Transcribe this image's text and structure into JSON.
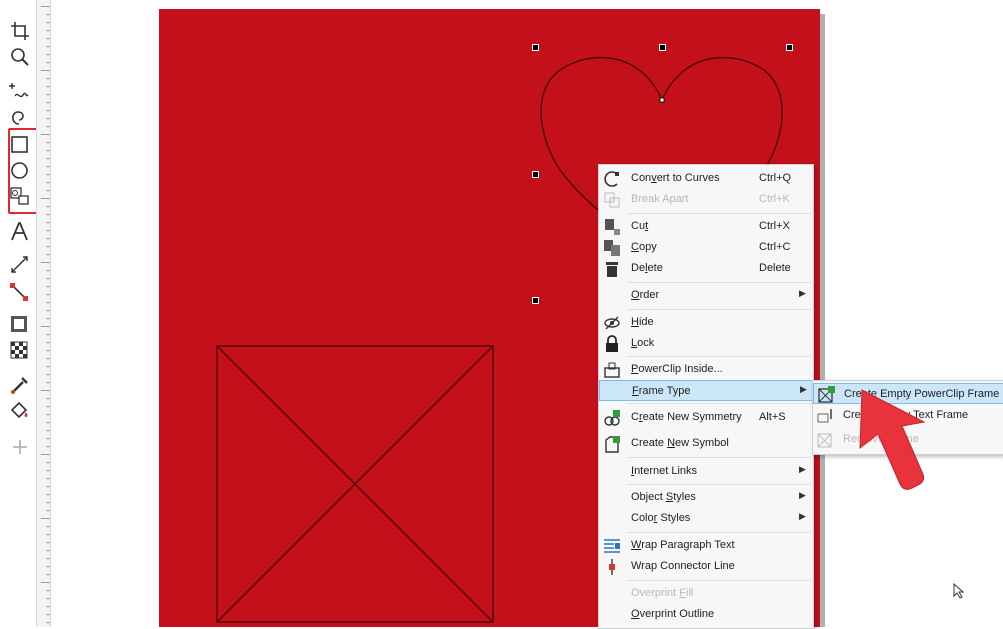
{
  "toolbox": {
    "tools": [
      {
        "name": "crop-tool-icon"
      },
      {
        "name": "zoom-tool-icon"
      },
      {
        "name": "freehand-tool-icon"
      },
      {
        "name": "artistic-media-tool-icon"
      },
      {
        "name": "rectangle-tool-icon"
      },
      {
        "name": "ellipse-tool-icon"
      },
      {
        "name": "placeholder-frame-tool-icon"
      },
      {
        "name": "text-tool-icon"
      },
      {
        "name": "dimension-tool-icon"
      },
      {
        "name": "connector-tool-icon"
      },
      {
        "name": "drop-shadow-tool-icon"
      },
      {
        "name": "transparency-tool-icon"
      },
      {
        "name": "eyedropper-tool-icon"
      },
      {
        "name": "interactive-fill-tool-icon"
      },
      {
        "name": "add-tool-icon"
      }
    ],
    "highlight_color": "#e0272f"
  },
  "canvas": {
    "page_color": "#c3101a",
    "outline_color": "#3a0306"
  },
  "context_menu": {
    "items": [
      {
        "label": "Convert to Curves",
        "mnemonic": "v",
        "shortcut": "Ctrl+Q",
        "disabled": false
      },
      {
        "label": "Break Apart",
        "shortcut": "Ctrl+K",
        "disabled": true
      },
      {
        "label": "Cut",
        "mnemonic": "t",
        "shortcut": "Ctrl+X",
        "disabled": false
      },
      {
        "label": "Copy",
        "mnemonic": "C",
        "shortcut": "Ctrl+C",
        "disabled": false
      },
      {
        "label": "Delete",
        "mnemonic": "l",
        "shortcut": "Delete",
        "disabled": false
      },
      {
        "label": "Order",
        "mnemonic": "O",
        "submenu": true
      },
      {
        "label": "Hide",
        "mnemonic": "H"
      },
      {
        "label": "Lock",
        "mnemonic": "L"
      },
      {
        "label": "PowerClip Inside...",
        "mnemonic": "P"
      },
      {
        "label": "Frame Type",
        "mnemonic": "F",
        "submenu": true,
        "highlighted": true
      },
      {
        "label": "Create New Symmetry",
        "mnemonic": "r",
        "shortcut": "Alt+S"
      },
      {
        "label": "Create New Symbol",
        "mnemonic": "N"
      },
      {
        "label": "Internet Links",
        "mnemonic": "I",
        "submenu": true
      },
      {
        "label": "Object Styles",
        "mnemonic": "S",
        "submenu": true
      },
      {
        "label": "Color Styles",
        "mnemonic": "r",
        "submenu": true
      },
      {
        "label": "Wrap Paragraph Text",
        "mnemonic": "W"
      },
      {
        "label": "Wrap Connector Line"
      },
      {
        "label": "Overprint Fill",
        "mnemonic": "F",
        "disabled": true
      },
      {
        "label": "Overprint Outline",
        "mnemonic": "O"
      }
    ]
  },
  "submenu": {
    "items": [
      {
        "label": "Create Empty PowerClip Frame",
        "highlighted": true
      },
      {
        "label": "Create Empty Text Frame"
      },
      {
        "label": "Remove Frame",
        "disabled": true
      }
    ]
  },
  "annotation": {
    "arrow_color": "#e8323c"
  }
}
